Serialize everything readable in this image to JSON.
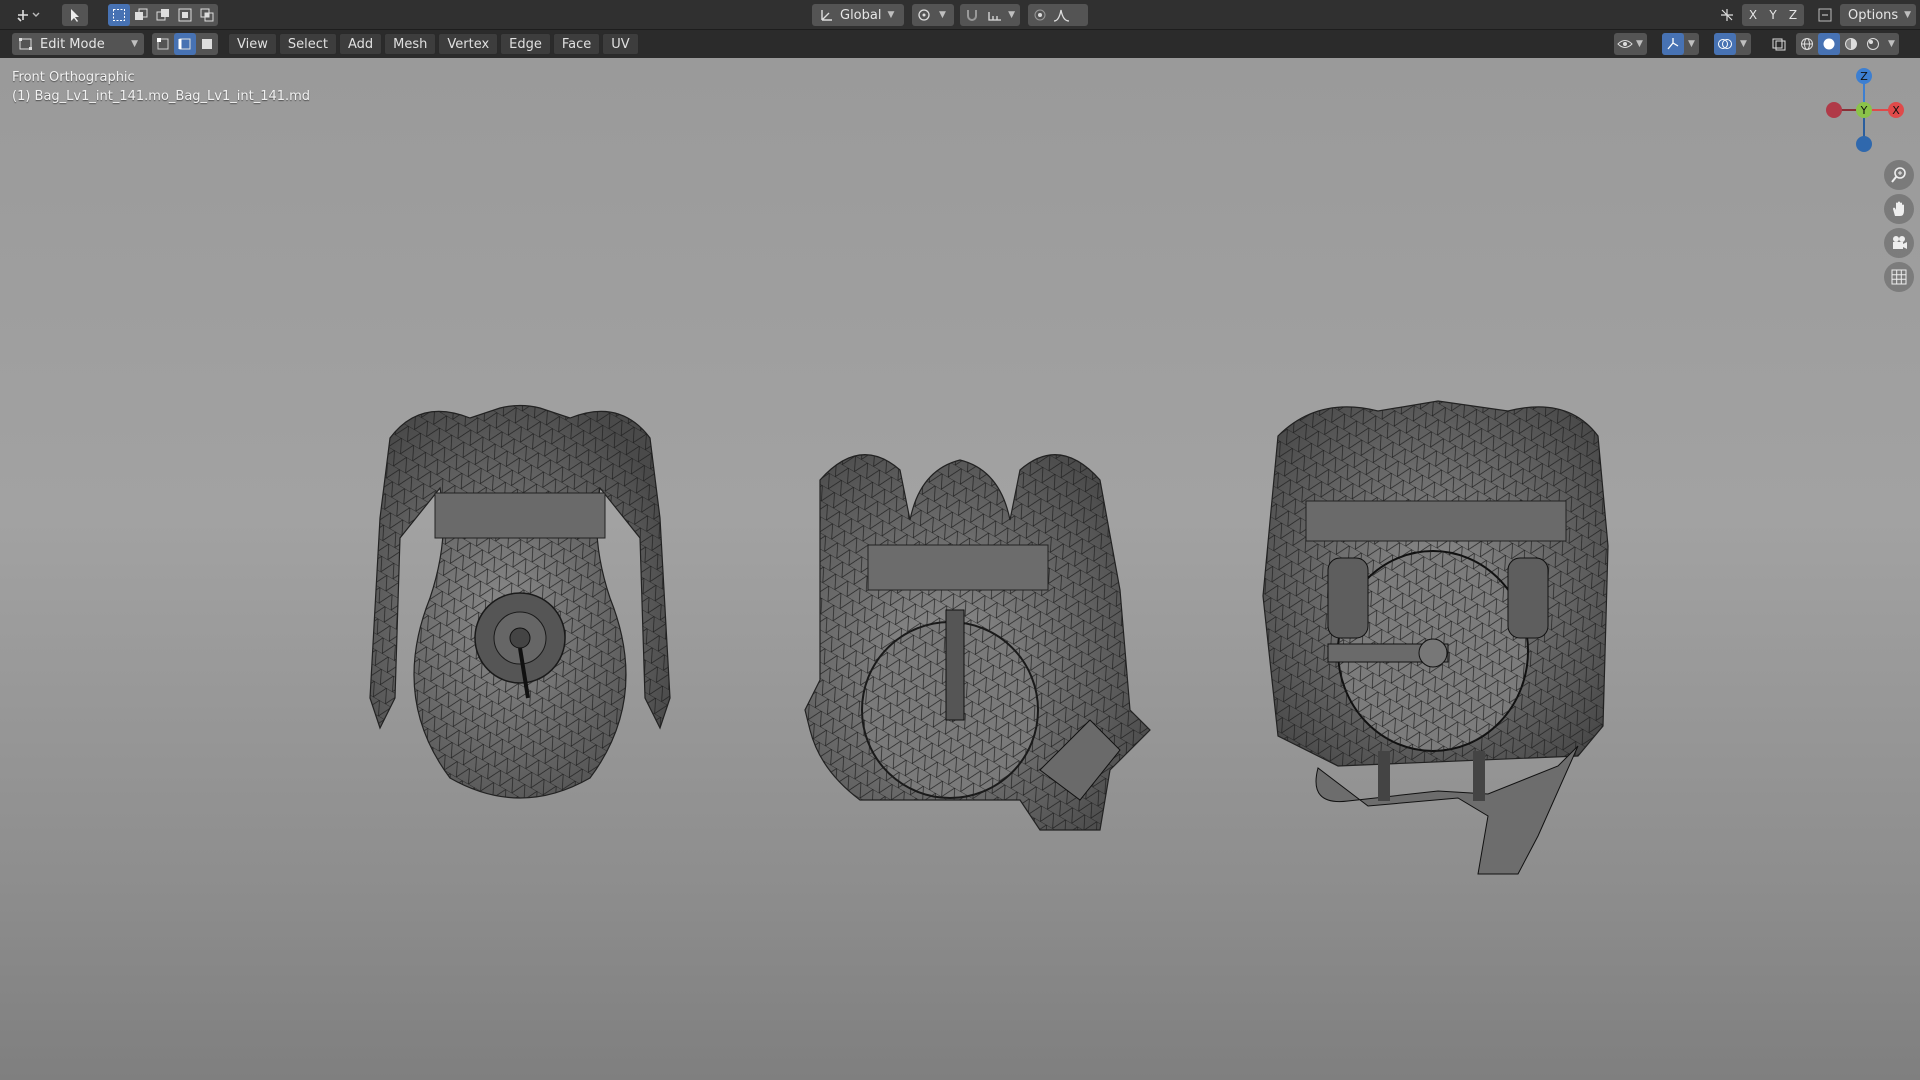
{
  "header": {
    "transform_orientation": "Global",
    "axis_labels": [
      "X",
      "Y",
      "Z"
    ],
    "options_label": "Options"
  },
  "toolbar": {
    "mode": "Edit Mode",
    "menus": [
      "View",
      "Select",
      "Add",
      "Mesh",
      "Vertex",
      "Edge",
      "Face",
      "UV"
    ]
  },
  "viewport": {
    "view_name": "Front Orthographic",
    "object_name": "(1) Bag_Lv1_int_141.mo_Bag_Lv1_int_141.md"
  },
  "gizmo": {
    "z": "Z",
    "y": "Y",
    "x": "X"
  },
  "colors": {
    "accent": "#4772b3",
    "x_axis": "#e04a4a",
    "y_axis": "#8bc34a",
    "z_axis": "#3d7fd1"
  }
}
